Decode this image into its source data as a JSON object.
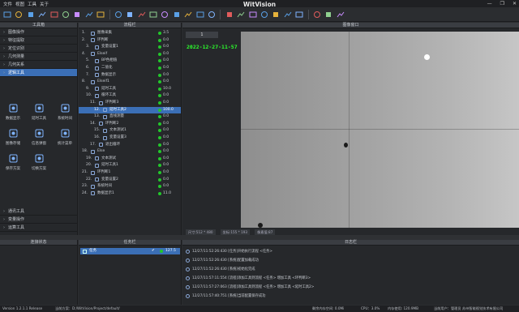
{
  "menu": [
    "文件",
    "视图",
    "工具",
    "关于"
  ],
  "app_title": "WitVision",
  "window_controls": [
    "minimize-icon",
    "restore-icon",
    "close-icon"
  ],
  "toolbar_icons": [
    "monitor-icon",
    "folder-open-icon",
    "save-icon",
    "blank-icon",
    "blank-icon",
    "toolbox-icon",
    "sync-icon",
    "pie-icon",
    "blank-icon",
    "stop-icon",
    "rect-icon",
    "eye-icon",
    "blank-icon",
    "image-icon",
    "chart-icon",
    "bars-icon",
    "chart-icon",
    "pen-icon",
    "ruler-icon",
    "square-icon",
    "circle-icon",
    "blank-icon",
    "line-icon",
    "grid-icon",
    "panel-icon",
    "blank-icon",
    "square-icon",
    "bracket-icon"
  ],
  "colors": {
    "accent": "#3b6fb6",
    "ok_dot": "#22c72b",
    "bg": "#26282b",
    "stamp": "#2cff2c"
  },
  "toolbox": {
    "title": "工具箱",
    "categories": [
      "图像操作",
      "特征提取",
      "定位识别",
      "几何测量",
      "几何关系",
      "逻辑工具"
    ],
    "selected_category": "逻辑工具",
    "tools": [
      {
        "label": "数据显示",
        "icon": "display-icon"
      },
      {
        "label": "延时工具",
        "icon": "delay-icon"
      },
      {
        "label": "系统时间",
        "icon": "clock-icon"
      },
      {
        "label": "图像存储",
        "icon": "image-save-icon"
      },
      {
        "label": "信息弹窗",
        "icon": "info-icon"
      },
      {
        "label": "统计菜单",
        "icon": "stats-icon"
      },
      {
        "label": "保存方案",
        "icon": "save-scheme-icon"
      },
      {
        "label": "切换方案",
        "icon": "switch-scheme-icon"
      }
    ],
    "bottom_categories": [
      "通讯工具",
      "变量操作",
      "运算工具"
    ]
  },
  "flow": {
    "title": "流程栏",
    "rows": [
      {
        "n": "1.",
        "label": "图像采集",
        "val": "3.5",
        "indent": 0
      },
      {
        "n": "2.",
        "label": "环判断",
        "val": "0.0",
        "indent": 0
      },
      {
        "n": "3.",
        "label": "变量设置1",
        "val": "0.0",
        "indent": 1
      },
      {
        "n": "4.",
        "label": "Elseif",
        "val": "0.0",
        "indent": 0
      },
      {
        "n": "5.",
        "label": "BP色相值",
        "val": "0.0",
        "indent": 1
      },
      {
        "n": "6.",
        "label": "二值化",
        "val": "0.0",
        "indent": 1
      },
      {
        "n": "7.",
        "label": "数据显示",
        "val": "0.0",
        "indent": 1
      },
      {
        "n": "8.",
        "label": "Elseif1",
        "val": "0.0",
        "indent": 0
      },
      {
        "n": "9.",
        "label": "延时工具",
        "val": "10.0",
        "indent": 1
      },
      {
        "n": "10.",
        "label": "循环工具",
        "val": "0.0",
        "indent": 1
      },
      {
        "n": "11.",
        "label": "环判断3",
        "val": "0.0",
        "indent": 2
      },
      {
        "n": "12.",
        "label": "延时工具2",
        "val": "100.0",
        "indent": 3,
        "selected": true
      },
      {
        "n": "13.",
        "label": "直线测量",
        "val": "0.0",
        "indent": 3
      },
      {
        "n": "14.",
        "label": "环判断2",
        "val": "0.0",
        "indent": 2
      },
      {
        "n": "15.",
        "label": "文本测试1",
        "val": "0.0",
        "indent": 3
      },
      {
        "n": "16.",
        "label": "变量设置3",
        "val": "0.0",
        "indent": 3
      },
      {
        "n": "17.",
        "label": "退出循环",
        "val": "0.0",
        "indent": 2
      },
      {
        "n": "18.",
        "label": "Else",
        "val": "0.0",
        "indent": 0
      },
      {
        "n": "19.",
        "label": "文本测试",
        "val": "0.0",
        "indent": 1
      },
      {
        "n": "20.",
        "label": "延时工具1",
        "val": "0.0",
        "indent": 1
      },
      {
        "n": "21.",
        "label": "环判断1",
        "val": "0.0",
        "indent": 0
      },
      {
        "n": "22.",
        "label": "变量设置2",
        "val": "0.0",
        "indent": 1
      },
      {
        "n": "23.",
        "label": "系统时间",
        "val": "0.0",
        "indent": 0
      },
      {
        "n": "24.",
        "label": "数据显示1",
        "val": "11.0",
        "indent": 0
      }
    ]
  },
  "image": {
    "title": "图像窗口",
    "tab_label": "1",
    "timestamp": "2022-12-27-11-57",
    "status": [
      "尺寸:512 * 480",
      "坐标:155 * 193",
      "像素值:87"
    ]
  },
  "connection": {
    "title": "连接状态"
  },
  "tasks": {
    "title": "任务栏",
    "row": {
      "label": "任务",
      "value": "127.5"
    }
  },
  "log": {
    "title": "日志栏",
    "rows": [
      "12/27/11:52:26:430 [任务]开始执行流程 <任务>",
      "12/27/11:52:26:430 [系统]配置加载成功",
      "12/27/11:52:26:430 [系统]初始化完成",
      "12/27/11:57:11:554 [流程]添加工具到流程 <任务> 增加工具 <环判断3>",
      "12/27/11:57:27:063 [流程]添加工具到流程 <任务> 增加工具 <延时工具2>",
      "12/27/11:57:40:751 [系统]当前配置保存成功"
    ]
  },
  "statusbar": {
    "version": "Version 1.2.1.1 Release",
    "scheme": "当前方案：D:/WitVision/Project/default/",
    "disk": "剩余内存空间: 0.0Mi",
    "cpu": "CPU：3.0%",
    "memory": "内存使用: 120.9MB",
    "user": "当前用户：管理员",
    "company": "苏州智能视觉技术有限公司"
  }
}
